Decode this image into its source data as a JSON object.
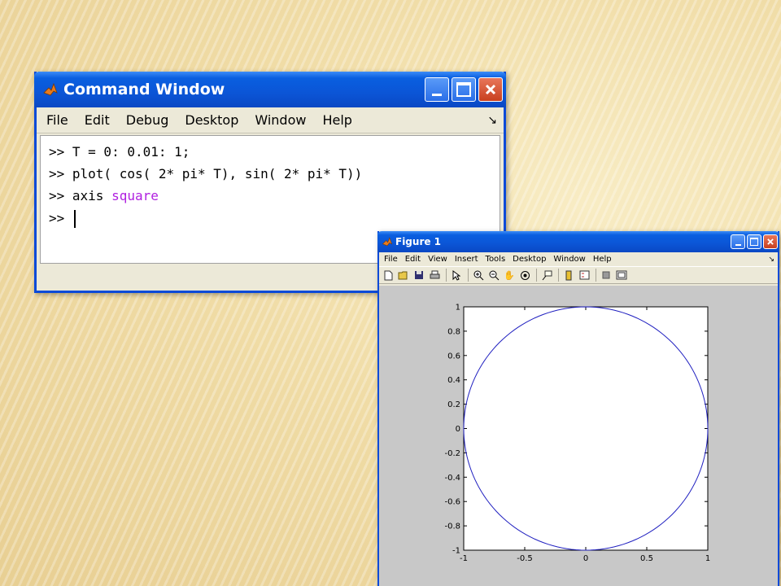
{
  "slide": {
    "title": ""
  },
  "command_window": {
    "title": "Command Window",
    "menu": [
      "File",
      "Edit",
      "Debug",
      "Desktop",
      "Window",
      "Help"
    ],
    "lines": [
      {
        "prompt": ">>",
        "code": " T = 0: 0.01: 1;"
      },
      {
        "prompt": ">>",
        "code": " plot( cos( 2* pi* T), sin( 2* pi* T))"
      },
      {
        "prompt": ">>",
        "code": " axis ",
        "keyword": "square"
      },
      {
        "prompt": ">>",
        "code": " "
      }
    ],
    "keyword_color": "#b020e0"
  },
  "figure_window": {
    "title": "Figure 1",
    "menu": [
      "File",
      "Edit",
      "View",
      "Insert",
      "Tools",
      "Desktop",
      "Window",
      "Help"
    ],
    "toolbar_icons": [
      "new-file-icon",
      "open-folder-icon",
      "save-icon",
      "print-icon",
      "pointer-icon",
      "zoom-in-icon",
      "zoom-out-icon",
      "pan-hand-icon",
      "rotate-icon",
      "data-cursor-icon",
      "colorbar-icon",
      "legend-icon",
      "hide-plot-tools-icon",
      "show-plot-tools-icon"
    ]
  },
  "chart_data": {
    "type": "line",
    "title": "",
    "xlabel": "",
    "ylabel": "",
    "xlim": [
      -1,
      1
    ],
    "ylim": [
      -1,
      1
    ],
    "x_ticks": [
      -1,
      -0.5,
      0,
      0.5,
      1
    ],
    "x_tick_labels": [
      "-1",
      "-0.5",
      "0",
      "0.5",
      "1"
    ],
    "y_ticks": [
      -1,
      -0.8,
      -0.6,
      -0.4,
      -0.2,
      0,
      0.2,
      0.4,
      0.6,
      0.8,
      1
    ],
    "y_tick_labels": [
      "-1",
      "-0.8",
      "-0.6",
      "-0.4",
      "-0.2",
      "0",
      "0.2",
      "0.4",
      "0.6",
      "0.8",
      "1"
    ],
    "grid": false,
    "line_color": "#2020c0",
    "series": [
      {
        "x": [
          1,
          0.9511,
          0.809,
          0.5878,
          0.309,
          0,
          -0.309,
          -0.5878,
          -0.809,
          -0.9511,
          -1,
          -0.9511,
          -0.809,
          -0.5878,
          -0.309,
          0,
          0.309,
          0.5878,
          0.809,
          0.9511,
          1
        ],
        "y": [
          0,
          0.309,
          0.5878,
          0.809,
          0.9511,
          1,
          0.9511,
          0.809,
          0.5878,
          0.309,
          0,
          -0.309,
          -0.5878,
          -0.809,
          -0.9511,
          -1,
          -0.9511,
          -0.809,
          -0.5878,
          -0.309,
          0
        ]
      }
    ]
  }
}
